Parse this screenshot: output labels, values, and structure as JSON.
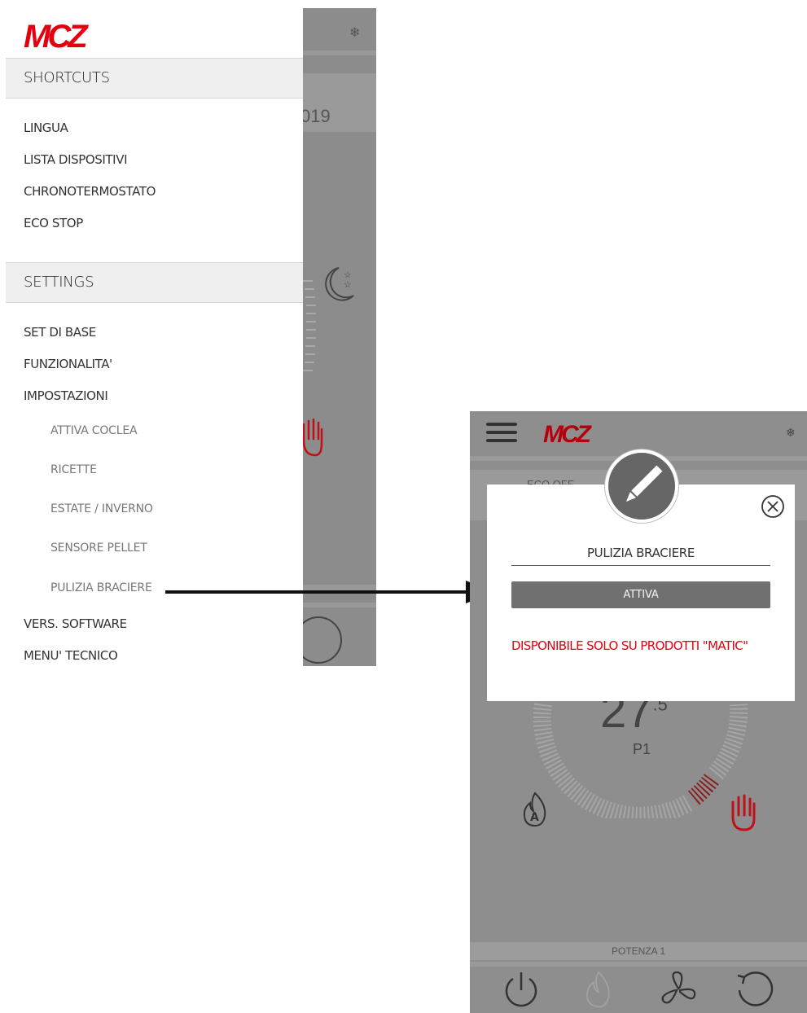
{
  "brand": {
    "logo_text": "MCZ",
    "color": "#e3000f"
  },
  "left_screen": {
    "background": {
      "year_fragment": "019",
      "snow_icon": "snowflake-icon",
      "moon_icon": "moon-stars-icon",
      "hand_icon": "hand-icon",
      "circle_icon": "restart-icon"
    },
    "drawer": {
      "shortcuts": {
        "header": "SHORTCUTS",
        "items": [
          "LINGUA",
          "LISTA DISPOSITIVI",
          "CHRONOTERMOSTATO",
          "ECO STOP"
        ]
      },
      "settings": {
        "header": "SETTINGS",
        "items": [
          "SET DI BASE",
          "FUNZIONALITA'",
          "IMPOSTAZIONI"
        ],
        "sub_items": [
          "ATTIVA COCLEA",
          "RICETTE",
          "ESTATE / INVERNO",
          "SENSORE PELLET",
          "PULIZIA BRACIERE"
        ],
        "trailing_items": [
          "VERS. SOFTWARE",
          "MENU' TECNICO"
        ]
      }
    }
  },
  "right_screen": {
    "topbar": {
      "menu_icon": "hamburger-icon",
      "snow_icon": "snowflake-icon"
    },
    "background": {
      "eco_label": "ECO OFF",
      "temperature": "27",
      "temperature_decimal": ".5",
      "power_level": "P1",
      "potenza_label": "POTENZA 1",
      "bottom_icons": [
        "power-icon",
        "flame-icon",
        "fan-icon",
        "restart-icon"
      ]
    },
    "modal": {
      "badge_icon": "pencil-icon",
      "close_icon": "close-circle-icon",
      "title": "PULIZIA BRACIERE",
      "button_label": "ATTIVA",
      "warning": "DISPONIBILE SOLO SU PRODOTTI \"MATIC\""
    }
  }
}
